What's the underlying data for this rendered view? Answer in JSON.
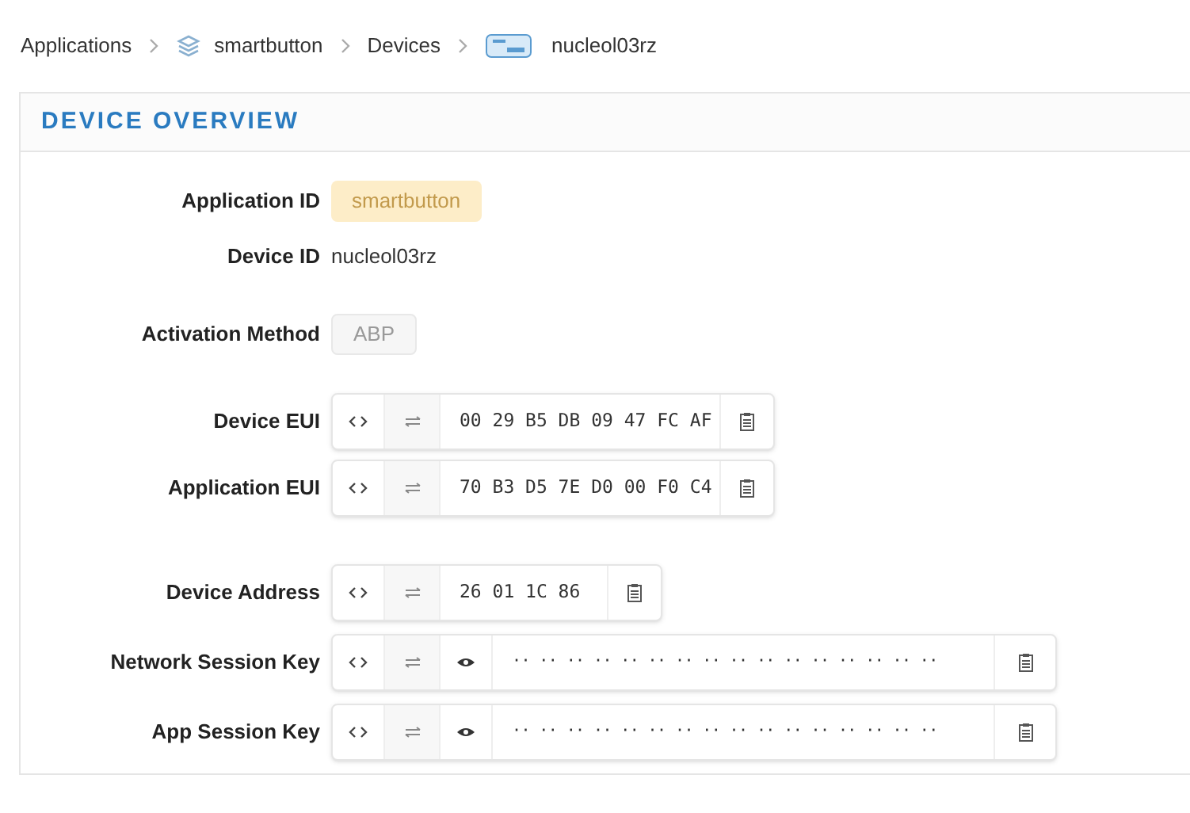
{
  "breadcrumb": [
    {
      "label": "Applications"
    },
    {
      "label": "smartbutton"
    },
    {
      "label": "Devices"
    },
    {
      "label": "nucleol03rz"
    }
  ],
  "panel": {
    "title": "DEVICE OVERVIEW"
  },
  "fields": [
    {
      "kind": "app-tag",
      "label": "Application ID",
      "value": "smartbutton"
    },
    {
      "kind": "text",
      "label": "Device ID",
      "value": "nucleol03rz"
    },
    {
      "kind": "method-tag",
      "label": "Activation Method",
      "value": "ABP"
    },
    {
      "kind": "hex",
      "label": "Device EUI",
      "value": "00 29 B5 DB 09 47 FC AF"
    },
    {
      "kind": "hex",
      "label": "Application EUI",
      "value": "70 B3 D5 7E D0 00 F0 C4"
    },
    {
      "kind": "hex",
      "label": "Device Address",
      "value": "26 01 1C 86"
    },
    {
      "kind": "secret",
      "label": "Network Session Key",
      "value": "·· ·· ·· ·· ·· ·· ·· ·· ·· ·· ·· ·· ·· ·· ·· ··"
    },
    {
      "kind": "secret",
      "label": "App Session Key",
      "value": "·· ·· ·· ·· ·· ·· ·· ·· ·· ·· ·· ·· ·· ·· ·· ··"
    }
  ]
}
